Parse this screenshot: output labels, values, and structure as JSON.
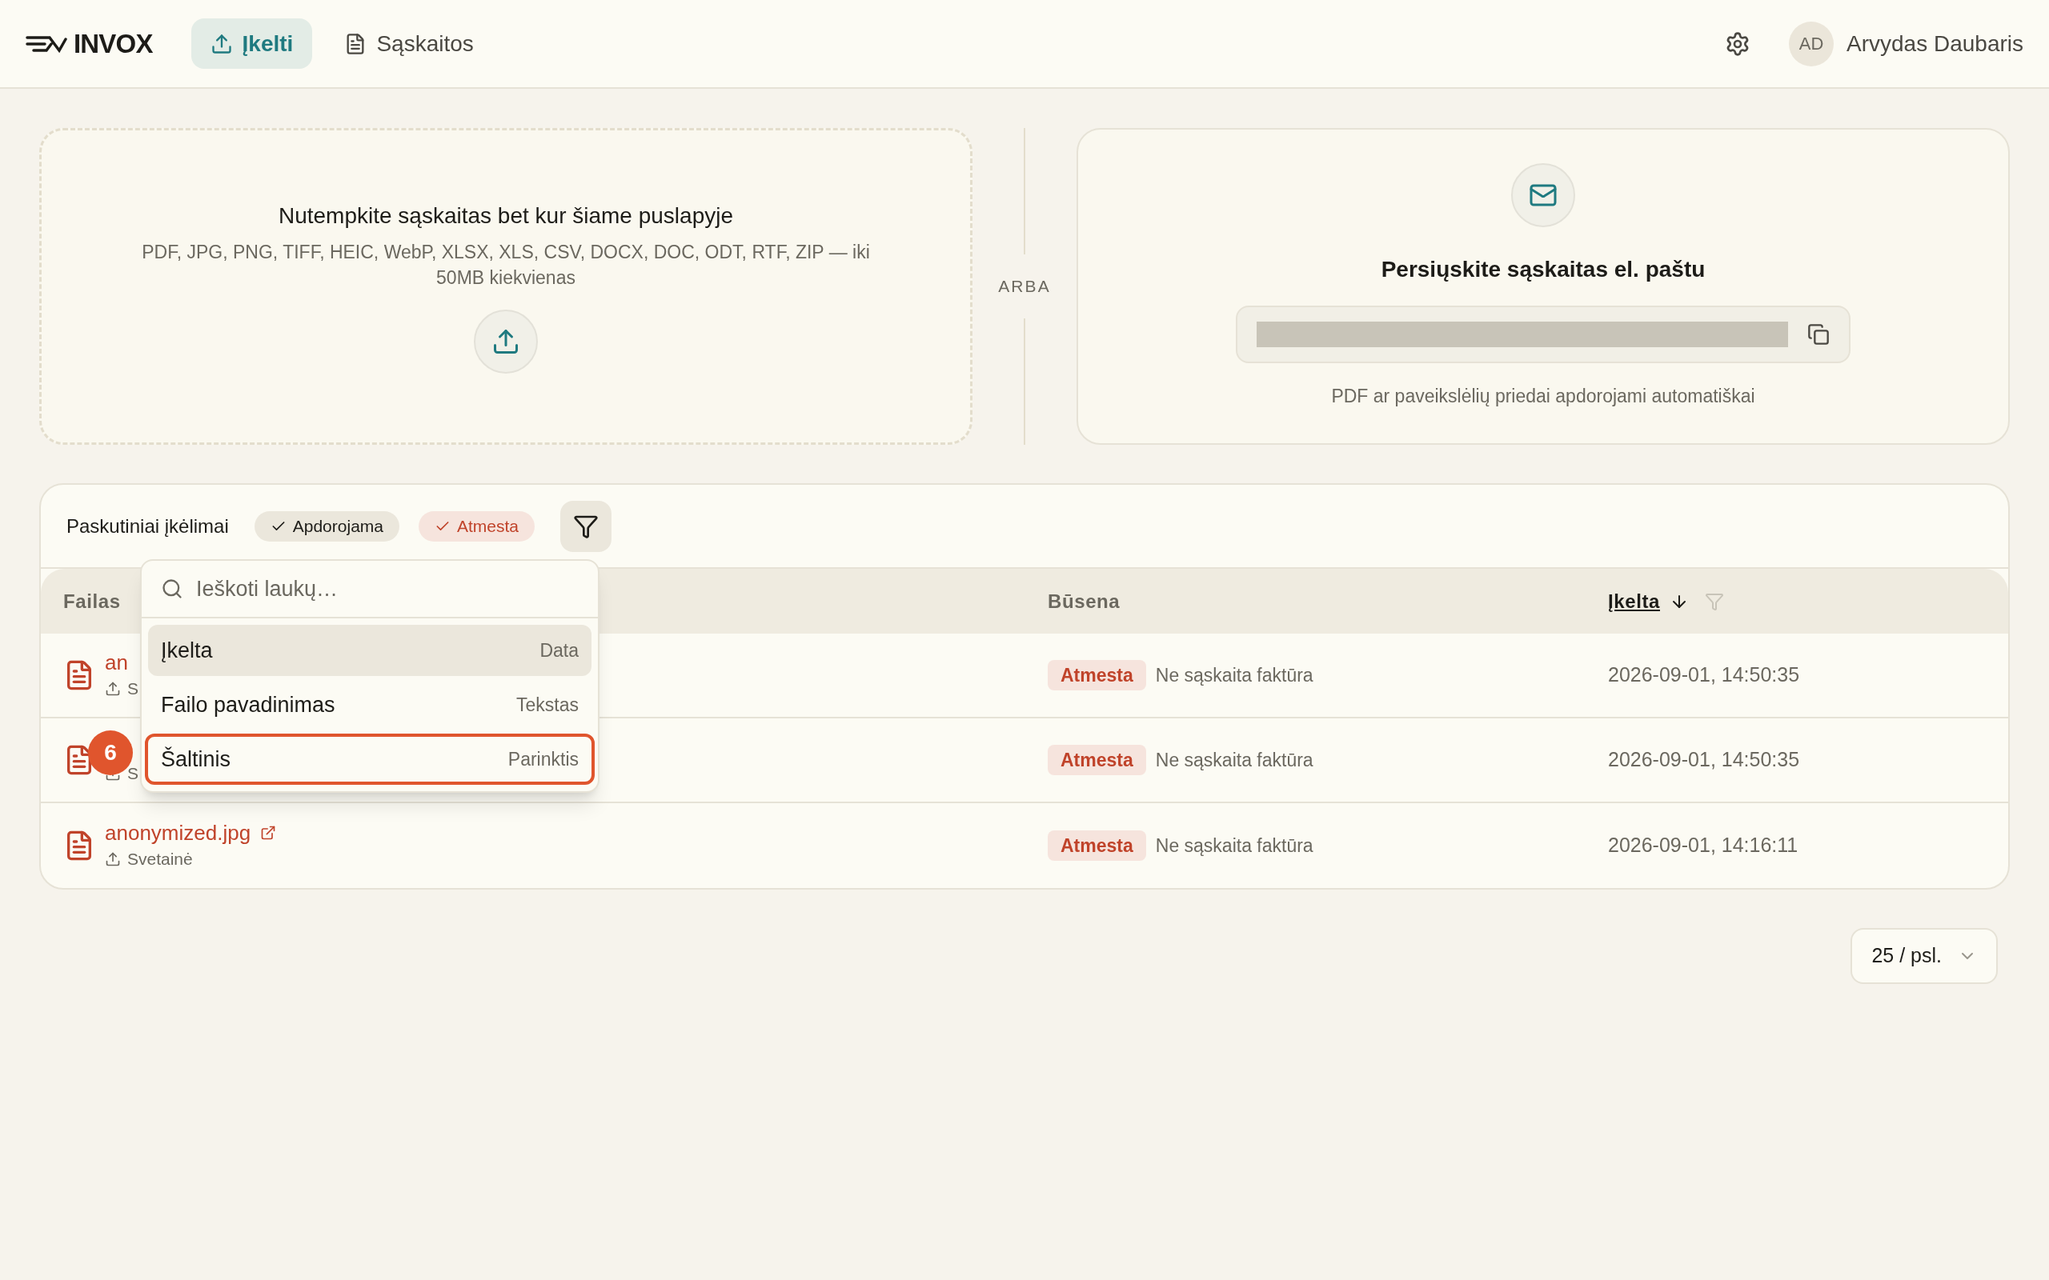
{
  "header": {
    "logo": "INVOX",
    "nav": [
      {
        "label": "Įkelti",
        "selected": true
      },
      {
        "label": "Sąskaitos",
        "selected": false
      }
    ],
    "user": {
      "initials": "AD",
      "name": "Arvydas Daubaris"
    }
  },
  "upload": {
    "title": "Nutempkite sąskaitas bet kur šiame puslapyje",
    "formats": "PDF, JPG, PNG, TIFF, HEIC, WebP, XLSX, XLS, CSV, DOCX, DOC, ODT, RTF, ZIP — iki 50MB kiekvienas"
  },
  "divider_label": "ARBA",
  "email": {
    "title": "Persiųskite sąskaitas el. paštu",
    "note": "PDF ar paveikslėlių priedai apdorojami automatiškai"
  },
  "recent": {
    "title": "Paskutiniai įkėlimai",
    "chips": [
      {
        "label": "Apdorojama",
        "kind": "neutral"
      },
      {
        "label": "Atmesta",
        "kind": "danger"
      }
    ]
  },
  "table": {
    "columns": [
      {
        "label": "Failas",
        "sorted": false
      },
      {
        "label": "Būsena",
        "sorted": false
      },
      {
        "label": "Įkelta",
        "sorted": true
      }
    ],
    "rows": [
      {
        "name": "an",
        "source": "S",
        "status": "Atmesta",
        "reason": "Ne sąskaita faktūra",
        "uploaded": "2026-09-01, 14:50:35"
      },
      {
        "source": "S",
        "status": "Atmesta",
        "reason": "Ne sąskaita faktūra",
        "uploaded": "2026-09-01, 14:50:35"
      },
      {
        "name": "anonymized.jpg",
        "source": "Svetainė",
        "link": true,
        "status": "Atmesta",
        "reason": "Ne sąskaita faktūra",
        "uploaded": "2026-09-01, 14:16:11"
      }
    ]
  },
  "field_menu": {
    "placeholder": "Ieškoti laukų…",
    "items": [
      {
        "label": "Įkelta",
        "type": "Data",
        "selected": true,
        "outlined": false
      },
      {
        "label": "Failo pavadinimas",
        "type": "Tekstas",
        "selected": false,
        "outlined": false
      },
      {
        "label": "Šaltinis",
        "type": "Parinktis",
        "selected": false,
        "outlined": true
      }
    ]
  },
  "step_badge": "6",
  "pagination": {
    "page_size": "25 / psl."
  }
}
